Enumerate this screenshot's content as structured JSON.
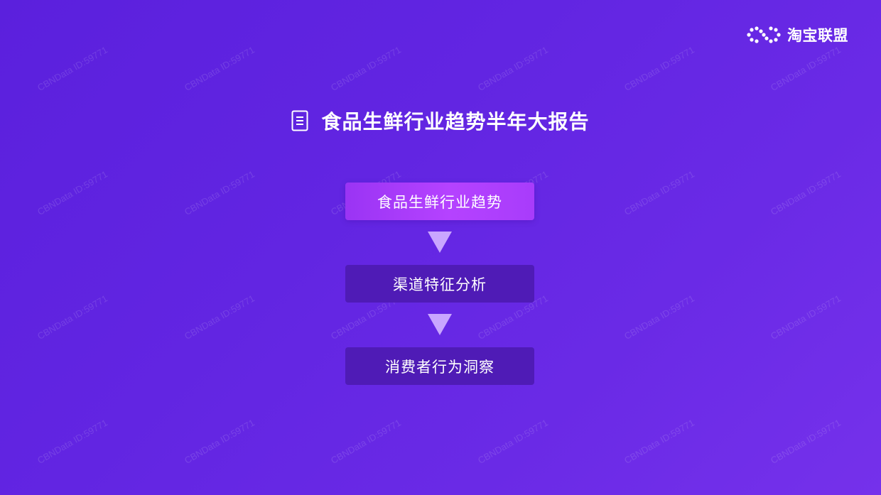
{
  "brand": {
    "name": "淘宝联盟",
    "logo_icon": "taobao-alliance-logo-icon"
  },
  "title": {
    "icon": "document-icon",
    "text": "食品生鲜行业趋势半年大报告"
  },
  "flow": {
    "steps": [
      {
        "label": "食品生鲜行业趋势",
        "state": "active"
      },
      {
        "label": "渠道特征分析",
        "state": "inactive"
      },
      {
        "label": "消费者行为洞察",
        "state": "inactive"
      }
    ],
    "arrow_icon": "triangle-down-icon"
  },
  "watermark": {
    "text": "CBNData ID:59771"
  },
  "colors": {
    "background_start": "#5b20dd",
    "background_end": "#7531eb",
    "active_step": "#b542ff",
    "inactive_step": "#4f1bb6",
    "arrow": "#c9a6ff",
    "text": "#ffffff"
  }
}
